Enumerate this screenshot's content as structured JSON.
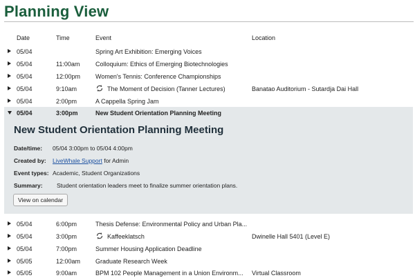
{
  "page_title": "Planning View",
  "columns": {
    "date": "Date",
    "time": "Time",
    "event": "Event",
    "location": "Location"
  },
  "rows_top": [
    {
      "date": "05/04",
      "time": "",
      "event": "Spring Art Exhibition: Emerging Voices",
      "location": ""
    },
    {
      "date": "05/04",
      "time": "11:00am",
      "event": "Colloquium: Ethics of Emerging Biotechnologies",
      "location": ""
    },
    {
      "date": "05/04",
      "time": "12:00pm",
      "event": "Women's Tennis: Conference Championships",
      "location": ""
    },
    {
      "date": "05/04",
      "time": "9:10am",
      "event": "The Moment of Decision (Tanner Lectures)",
      "location": "Banatao Auditorium - Sutardja Dai Hall",
      "icon": "repeat-icon"
    },
    {
      "date": "05/04",
      "time": "2:00pm",
      "event": "A Cappella Spring Jam",
      "location": ""
    }
  ],
  "open_row": {
    "date": "05/04",
    "time": "3:00pm",
    "event": "New Student Orientation Planning Meeting"
  },
  "detail": {
    "title": "New Student Orientation Planning Meeting",
    "datetime_label": "Date/time:",
    "datetime_value": "05/04 3:00pm to 05/04 4:00pm",
    "created_label": "Created by:",
    "created_link": "LiveWhale Support",
    "created_suffix": "for Admin",
    "types_label": "Event types:",
    "types_value": "Academic, Student Organizations",
    "summary_label": "Summary:",
    "summary_value": "Student orientation leaders meet to finalize summer orientation plans.",
    "button": "View on calendar"
  },
  "rows_bottom": [
    {
      "date": "05/04",
      "time": "6:00pm",
      "event": "Thesis Defense: Environmental Policy and Urban Pla...",
      "location": ""
    },
    {
      "date": "05/04",
      "time": "3:00pm",
      "event": "Kaffeeklatsch",
      "location": "Dwinelle Hall 5401 (Level E)",
      "icon": "repeat-icon"
    },
    {
      "date": "05/04",
      "time": "7:00pm",
      "event": "Summer Housing Application Deadline",
      "location": ""
    },
    {
      "date": "05/05",
      "time": "12:00am",
      "event": "Graduate Research Week",
      "location": ""
    },
    {
      "date": "05/05",
      "time": "9:00am",
      "event": "BPM 102 People Management in a Union Environm...",
      "location": "Virtual Classroom"
    }
  ]
}
